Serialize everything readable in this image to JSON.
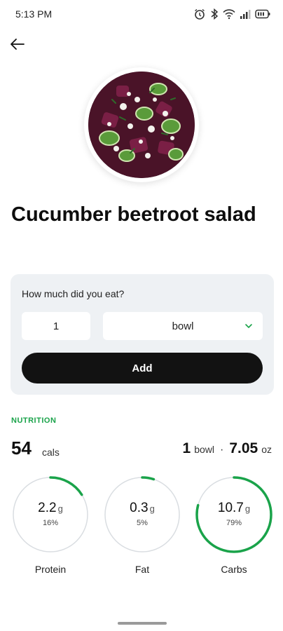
{
  "status_bar": {
    "time": "5:13 PM"
  },
  "food": {
    "name": "Cucumber beetroot salad"
  },
  "amount_card": {
    "question": "How much did you eat?",
    "quantity": "1",
    "unit": "bowl",
    "add_label": "Add"
  },
  "nutrition": {
    "section_label": "NUTRITION",
    "calories": "54",
    "calories_unit": "cals",
    "serving_qty": "1",
    "serving_unit": "bowl",
    "separator": "·",
    "weight": "7.05",
    "weight_unit": "oz",
    "macros": [
      {
        "name": "Protein",
        "value": "2.2",
        "unit": "g",
        "percent_label": "16%",
        "fraction": 0.16
      },
      {
        "name": "Fat",
        "value": "0.3",
        "unit": "g",
        "percent_label": "5%",
        "fraction": 0.05
      },
      {
        "name": "Carbs",
        "value": "10.7",
        "unit": "g",
        "percent_label": "79%",
        "fraction": 0.79
      }
    ]
  },
  "colors": {
    "accent": "#1aa34a",
    "ring_track": "#d9dde1",
    "button": "#121212",
    "card_bg": "#eef1f4"
  }
}
